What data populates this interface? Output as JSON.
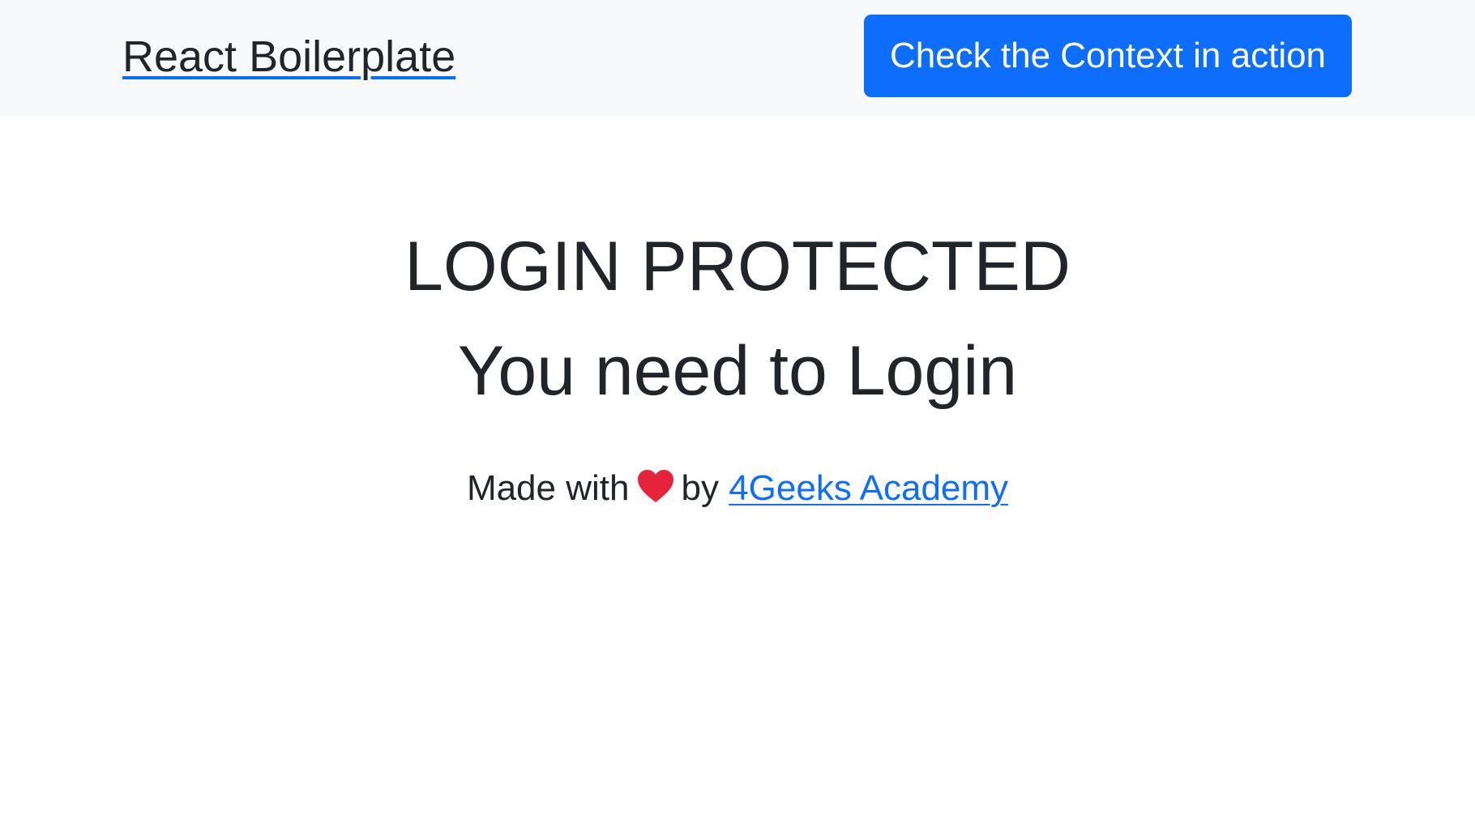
{
  "navbar": {
    "brand": "React Boilerplate",
    "context_button": "Check the Context in action"
  },
  "main": {
    "title": "LOGIN PROTECTED",
    "subtitle": "You need to Login",
    "footer": {
      "made_with": "Made with",
      "heart_icon": "heart-icon",
      "by": "by",
      "link_text": "4Geeks Academy"
    }
  },
  "colors": {
    "navbar_bg": "#f8f9fa",
    "primary": "#0d6efd",
    "text": "#212529",
    "heart": "#e5243b"
  }
}
